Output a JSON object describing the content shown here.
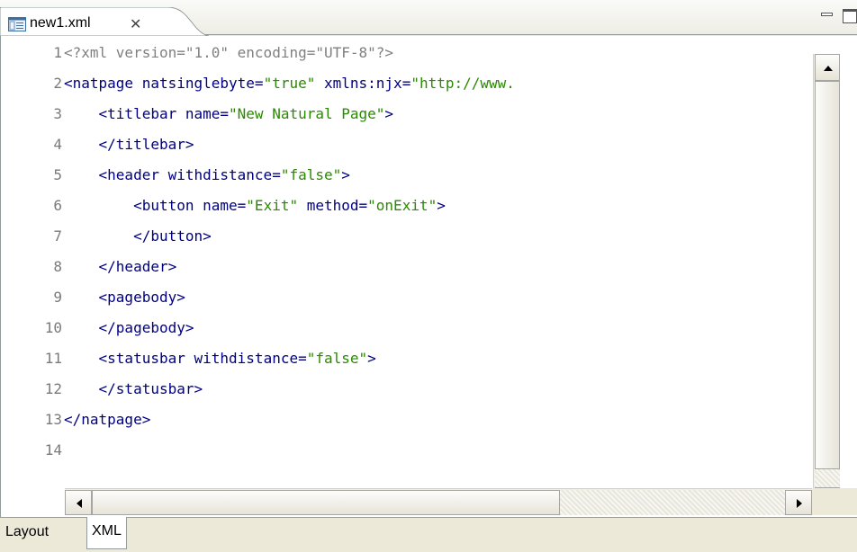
{
  "editor_tab": {
    "title": "new1.xml",
    "close_glyph": "✕",
    "icon": "xml-file-icon"
  },
  "window_controls": {
    "minimize_icon": "minimize-icon",
    "maximize_icon": "maximize-icon"
  },
  "code": {
    "lines": [
      {
        "num": "1",
        "segments": [
          {
            "cls": "t-decl",
            "text": "<?xml version=\"1.0\" encoding=\"UTF-8\"?>"
          }
        ]
      },
      {
        "num": "2",
        "segments": [
          {
            "cls": "t-tag",
            "text": "<natpage "
          },
          {
            "cls": "t-attrname",
            "text": "natsinglebyte="
          },
          {
            "cls": "t-val",
            "text": "\"true\""
          },
          {
            "cls": "t-attrname",
            "text": " xmlns:njx="
          },
          {
            "cls": "t-val",
            "text": "\"http://www."
          }
        ]
      },
      {
        "num": "3",
        "segments": [
          {
            "cls": "t-plain",
            "text": "    "
          },
          {
            "cls": "t-tag",
            "text": "<titlebar "
          },
          {
            "cls": "t-attrname",
            "text": "name="
          },
          {
            "cls": "t-val",
            "text": "\"New Natural Page\""
          },
          {
            "cls": "t-tag",
            "text": ">"
          }
        ]
      },
      {
        "num": "4",
        "segments": [
          {
            "cls": "t-plain",
            "text": "    "
          },
          {
            "cls": "t-tag",
            "text": "</titlebar>"
          }
        ]
      },
      {
        "num": "5",
        "segments": [
          {
            "cls": "t-plain",
            "text": "    "
          },
          {
            "cls": "t-tag",
            "text": "<header "
          },
          {
            "cls": "t-attrname",
            "text": "withdistance="
          },
          {
            "cls": "t-val",
            "text": "\"false\""
          },
          {
            "cls": "t-tag",
            "text": ">"
          }
        ]
      },
      {
        "num": "6",
        "segments": [
          {
            "cls": "t-plain",
            "text": "        "
          },
          {
            "cls": "t-tag",
            "text": "<button "
          },
          {
            "cls": "t-attrname",
            "text": "name="
          },
          {
            "cls": "t-val",
            "text": "\"Exit\""
          },
          {
            "cls": "t-attrname",
            "text": " method="
          },
          {
            "cls": "t-val",
            "text": "\"onExit\""
          },
          {
            "cls": "t-tag",
            "text": ">"
          }
        ]
      },
      {
        "num": "7",
        "segments": [
          {
            "cls": "t-plain",
            "text": "        "
          },
          {
            "cls": "t-tag",
            "text": "</button>"
          }
        ]
      },
      {
        "num": "8",
        "segments": [
          {
            "cls": "t-plain",
            "text": "    "
          },
          {
            "cls": "t-tag",
            "text": "</header>"
          }
        ]
      },
      {
        "num": "9",
        "segments": [
          {
            "cls": "t-plain",
            "text": "    "
          },
          {
            "cls": "t-tag",
            "text": "<pagebody>"
          }
        ]
      },
      {
        "num": "10",
        "segments": [
          {
            "cls": "t-plain",
            "text": "    "
          },
          {
            "cls": "t-tag",
            "text": "</pagebody>"
          }
        ]
      },
      {
        "num": "11",
        "segments": [
          {
            "cls": "t-plain",
            "text": "    "
          },
          {
            "cls": "t-tag",
            "text": "<statusbar "
          },
          {
            "cls": "t-attrname",
            "text": "withdistance="
          },
          {
            "cls": "t-val",
            "text": "\"false\""
          },
          {
            "cls": "t-tag",
            "text": ">"
          }
        ]
      },
      {
        "num": "12",
        "segments": [
          {
            "cls": "t-plain",
            "text": "    "
          },
          {
            "cls": "t-tag",
            "text": "</statusbar>"
          }
        ]
      },
      {
        "num": "13",
        "segments": [
          {
            "cls": "t-tag",
            "text": "</natpage>"
          }
        ]
      },
      {
        "num": "14",
        "segments": []
      }
    ]
  },
  "bottom_tabs": {
    "layout": "Layout",
    "xml": "XML",
    "active": "XML"
  },
  "colors": {
    "tag": "#000080",
    "value": "#2a8a00",
    "declaration": "#808080",
    "line_number": "#7a7a7a"
  }
}
